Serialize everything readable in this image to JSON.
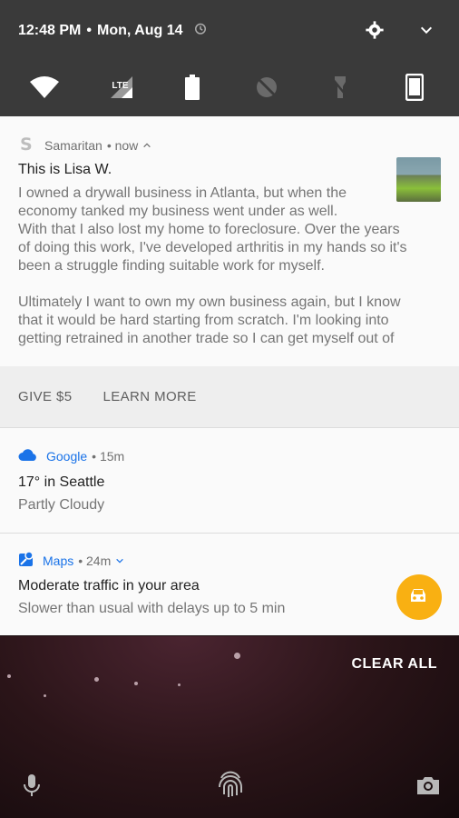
{
  "status": {
    "time": "12:48 PM",
    "sep": "•",
    "date": "Mon, Aug 14"
  },
  "quick_settings": {
    "lte_label": "LTE"
  },
  "notif1": {
    "app": "Samaritan",
    "time": "• now",
    "title": "This is Lisa W.",
    "lines": [
      "I owned a drywall business in Atlanta, but when the",
      "economy tanked my business went under as well.",
      "With that I also lost my home to foreclosure. Over the years",
      "of doing this work, I've developed arthritis in my hands so it's",
      "been a struggle finding suitable work for myself.",
      "Ultimately I want to own my own business again, but I know",
      "that it would be hard starting from scratch. I'm looking into",
      "getting retrained in another trade so I can get myself out of"
    ],
    "actions": [
      "GIVE $5",
      "LEARN MORE"
    ]
  },
  "notif2": {
    "app": "Google",
    "time": "• 15m",
    "title": "17° in Seattle",
    "text": "Partly Cloudy"
  },
  "notif3": {
    "app": "Maps",
    "time": "• 24m",
    "title": "Moderate traffic in your area",
    "text": "Slower than usual with delays up to 5 min"
  },
  "clear_all": "CLEAR ALL",
  "colors": {
    "accent_blue": "#1a73e8",
    "fab": "#f9b012",
    "shade": "#3a3a3a"
  }
}
